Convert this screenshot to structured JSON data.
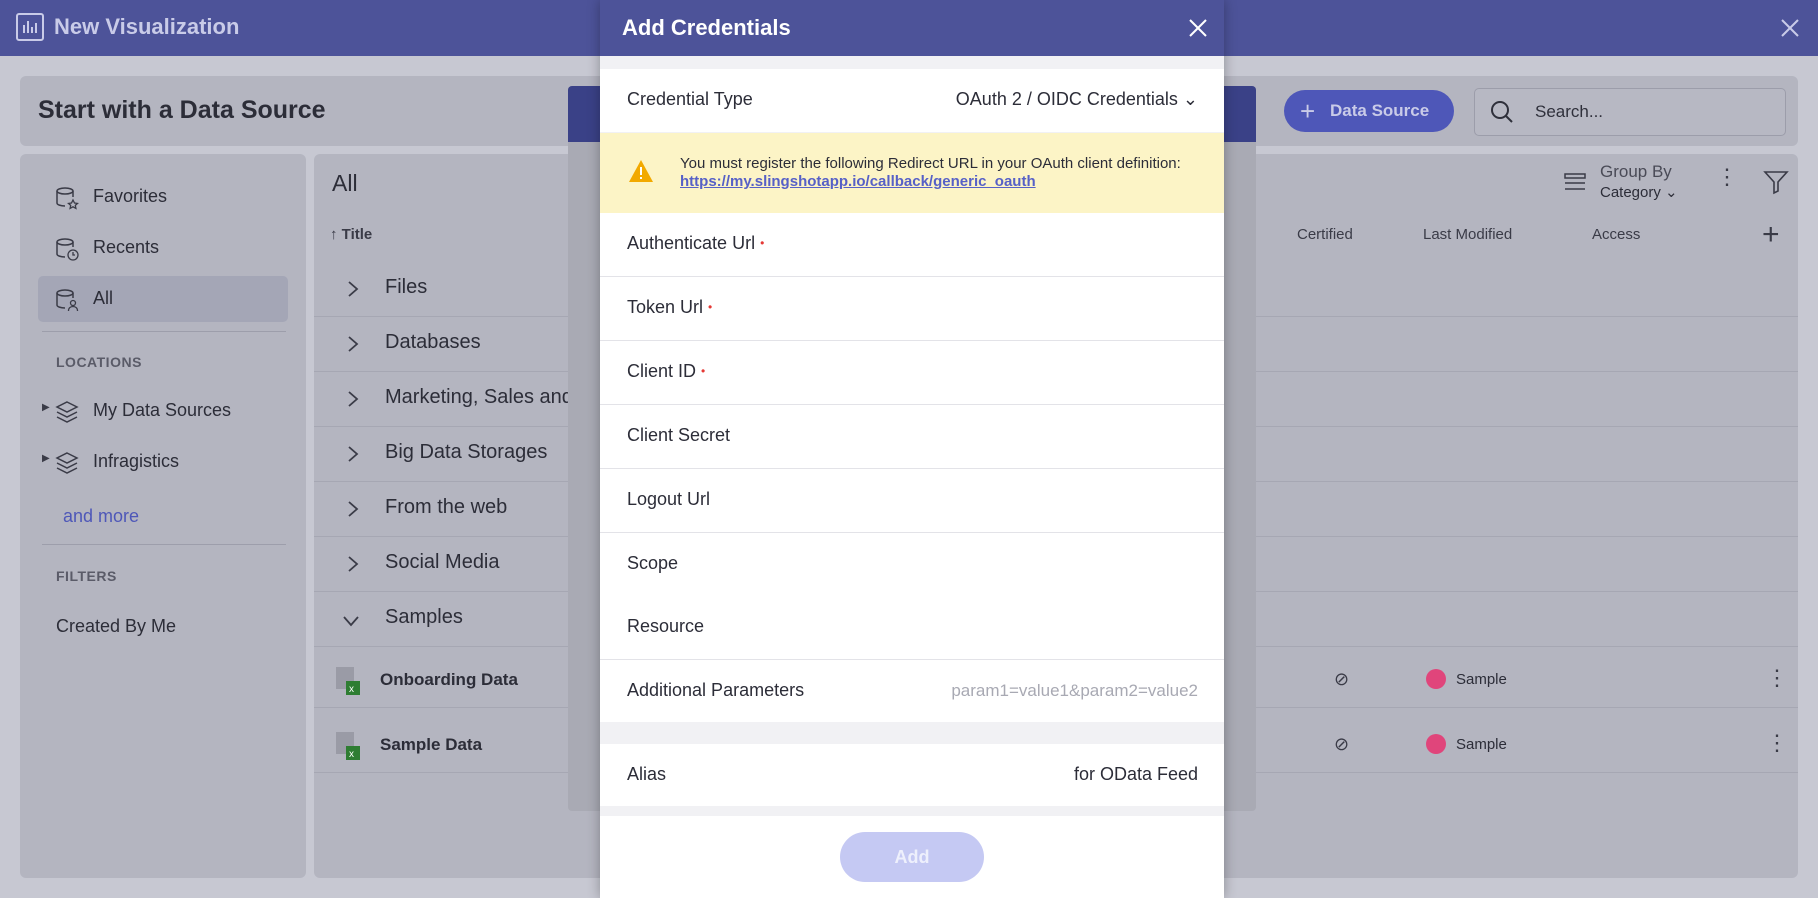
{
  "app": {
    "title": "New Visualization"
  },
  "page": {
    "heading": "Start with a Data Source"
  },
  "toolbar": {
    "data_source_label": "Data Source",
    "search_placeholder": "Search..."
  },
  "sidebar": {
    "items": [
      {
        "label": "Favorites"
      },
      {
        "label": "Recents"
      },
      {
        "label": "All"
      }
    ],
    "locations_header": "LOCATIONS",
    "locations": [
      {
        "label": "My Data Sources"
      },
      {
        "label": "Infragistics"
      }
    ],
    "and_more": "and more",
    "filters_header": "FILTERS",
    "filters": [
      {
        "label": "Created By Me"
      }
    ]
  },
  "list": {
    "heading": "All",
    "group_by_label": "Group By",
    "group_by_value": "Category",
    "columns": {
      "title": "Title",
      "certified": "Certified",
      "last_modified": "Last Modified",
      "access": "Access"
    },
    "categories": [
      {
        "label": "Files"
      },
      {
        "label": "Databases"
      },
      {
        "label": "Marketing, Sales and"
      },
      {
        "label": "Big Data Storages"
      },
      {
        "label": "From the web"
      },
      {
        "label": "Social Media"
      },
      {
        "label": "Samples"
      }
    ],
    "files": [
      {
        "title": "Onboarding Data",
        "access": "Sample"
      },
      {
        "title": "Sample Data",
        "access": "Sample"
      }
    ]
  },
  "dialog": {
    "title": "Add Credentials",
    "credential_type_label": "Credential Type",
    "credential_type_value": "OAuth 2 / OIDC Credentials",
    "warning_text": "You must register the following Redirect URL in your OAuth client definition:",
    "warning_link": "https://my.slingshotapp.io/callback/generic_oauth",
    "fields": [
      {
        "label": "Authenticate Url",
        "required": "•"
      },
      {
        "label": "Token Url",
        "required": "•"
      },
      {
        "label": "Client ID",
        "required": "•"
      },
      {
        "label": "Client Secret"
      },
      {
        "label": "Logout Url"
      },
      {
        "label": "Scope"
      },
      {
        "label": "Resource"
      },
      {
        "label": "Additional Parameters",
        "placeholder": "param1=value1&param2=value2"
      }
    ],
    "alias_label": "Alias",
    "alias_value": "for OData Feed",
    "add_label": "Add"
  },
  "colors": {
    "header": "#4d5399",
    "accent": "#4e57b8",
    "warning_bg": "#fcf4c6",
    "required": "#e53935"
  }
}
